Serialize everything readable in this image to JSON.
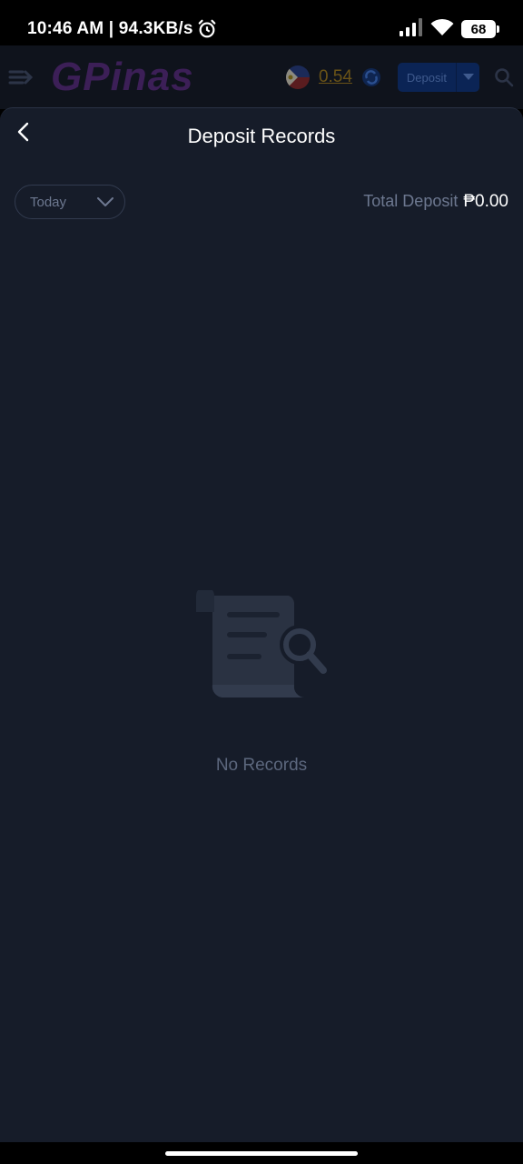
{
  "status_bar": {
    "time_speed": "10:46 AM | 94.3KB/s",
    "battery": "68"
  },
  "app_header": {
    "logo_text": "GPinas",
    "balance": "0.54",
    "deposit_label": "Deposit"
  },
  "sheet": {
    "title": "Deposit Records",
    "date_filter": "Today",
    "total_label": "Total Deposit",
    "total_value": "₱0.00",
    "empty_text": "No Records"
  },
  "colors": {
    "sheet_bg": "#161c29",
    "accent_deposit": "#0b2455",
    "muted_text": "#6d7890"
  }
}
